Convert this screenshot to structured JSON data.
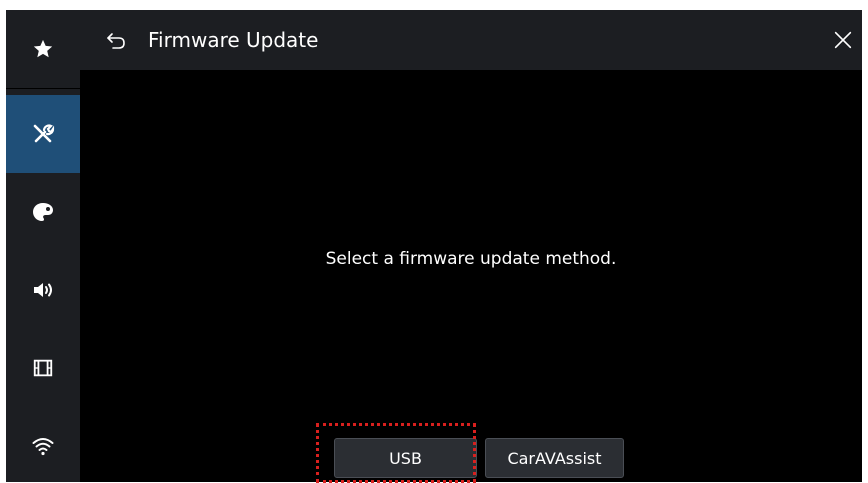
{
  "header": {
    "title": "Firmware Update",
    "back_icon": "back-arrow-icon",
    "close_icon": "close-icon"
  },
  "sidebar": {
    "items": [
      {
        "icon": "star-icon",
        "active": false
      },
      {
        "icon": "tools-icon",
        "active": true
      },
      {
        "icon": "palette-icon",
        "active": false
      },
      {
        "icon": "speaker-icon",
        "active": false
      },
      {
        "icon": "film-icon",
        "active": false
      },
      {
        "icon": "wifi-icon",
        "active": false
      }
    ]
  },
  "main": {
    "message": "Select a firmware update method."
  },
  "buttons": {
    "usb_label": "USB",
    "caravassist_label": "CarAVAssist"
  },
  "colors": {
    "background": "#000000",
    "panel": "#1c1e22",
    "active": "#1f4f78",
    "highlight": "#d9201e"
  }
}
